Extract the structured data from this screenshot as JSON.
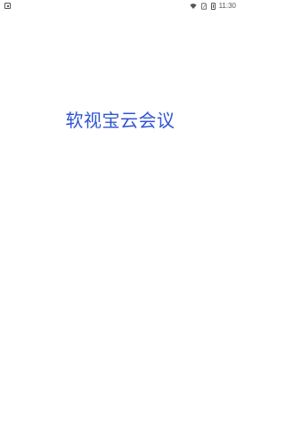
{
  "status_bar": {
    "time": "11:30",
    "icons": [
      "app-notification-icon",
      "wifi-icon",
      "sim-icon",
      "battery-icon"
    ]
  },
  "splash": {
    "title": "软视宝云会议",
    "title_color": "#2f55d4"
  }
}
